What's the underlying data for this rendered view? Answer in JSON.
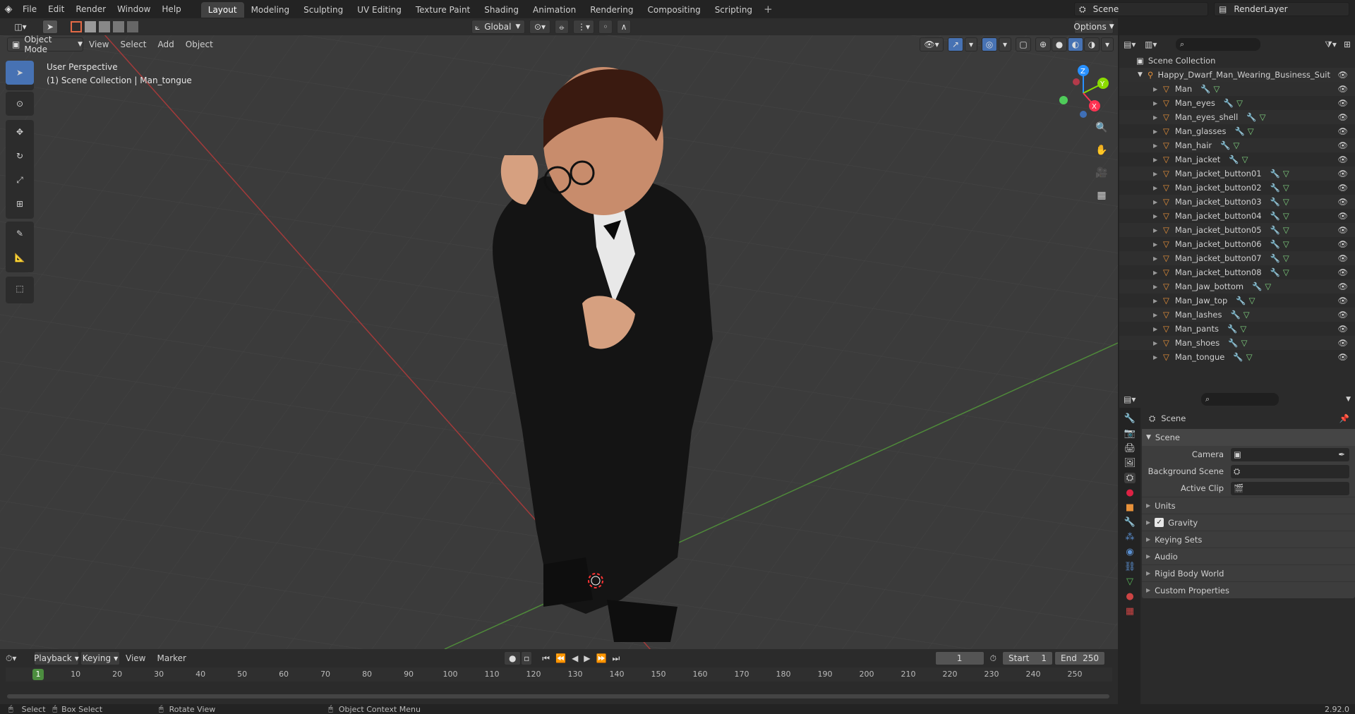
{
  "menu": {
    "file": "File",
    "edit": "Edit",
    "render": "Render",
    "window": "Window",
    "help": "Help"
  },
  "workspaces": [
    "Layout",
    "Modeling",
    "Sculpting",
    "UV Editing",
    "Texture Paint",
    "Shading",
    "Animation",
    "Rendering",
    "Compositing",
    "Scripting"
  ],
  "scene_name": "Scene",
  "render_layer": "RenderLayer",
  "header": {
    "mode": "Object Mode",
    "view": "View",
    "select": "Select",
    "add": "Add",
    "object": "Object",
    "orientation": "Global",
    "options": "Options"
  },
  "viewport": {
    "perspective": "User Perspective",
    "context": "(1) Scene Collection | Man_tongue",
    "axis_x": "X",
    "axis_y": "Y",
    "axis_z": "Z"
  },
  "outliner": {
    "root": "Scene Collection",
    "collection": "Happy_Dwarf_Man_Wearing_Business_Suit",
    "items": [
      "Man",
      "Man_eyes",
      "Man_eyes_shell",
      "Man_glasses",
      "Man_hair",
      "Man_jacket",
      "Man_jacket_button01",
      "Man_jacket_button02",
      "Man_jacket_button03",
      "Man_jacket_button04",
      "Man_jacket_button05",
      "Man_jacket_button06",
      "Man_jacket_button07",
      "Man_jacket_button08",
      "Man_Jaw_bottom",
      "Man_Jaw_top",
      "Man_lashes",
      "Man_pants",
      "Man_shoes",
      "Man_tongue"
    ]
  },
  "properties": {
    "title": "Scene",
    "panel": "Scene",
    "camera_label": "Camera",
    "bg_scene_label": "Background Scene",
    "active_clip_label": "Active Clip",
    "subpanels": [
      "Units",
      "Gravity",
      "Keying Sets",
      "Audio",
      "Rigid Body World",
      "Custom Properties"
    ],
    "gravity_checked": true
  },
  "timeline": {
    "playback": "Playback",
    "keying": "Keying",
    "view": "View",
    "marker": "Marker",
    "current_frame": "1",
    "start_label": "Start",
    "start": "1",
    "end_label": "End",
    "end": "250",
    "ticks": [
      "10",
      "20",
      "30",
      "40",
      "50",
      "60",
      "70",
      "80",
      "90",
      "100",
      "110",
      "120",
      "130",
      "140",
      "150",
      "160",
      "170",
      "180",
      "190",
      "200",
      "210",
      "220",
      "230",
      "240",
      "250"
    ],
    "frame_marker": "1"
  },
  "status": {
    "select": "Select",
    "box_select": "Box Select",
    "rotate_view": "Rotate View",
    "context_menu": "Object Context Menu",
    "version": "2.92.0"
  },
  "colors": {
    "accent": "#4772b3",
    "mesh_icon": "#e8923a",
    "x_axis": "#ff3352",
    "y_axis": "#8bdc00",
    "z_axis": "#2890ff"
  }
}
